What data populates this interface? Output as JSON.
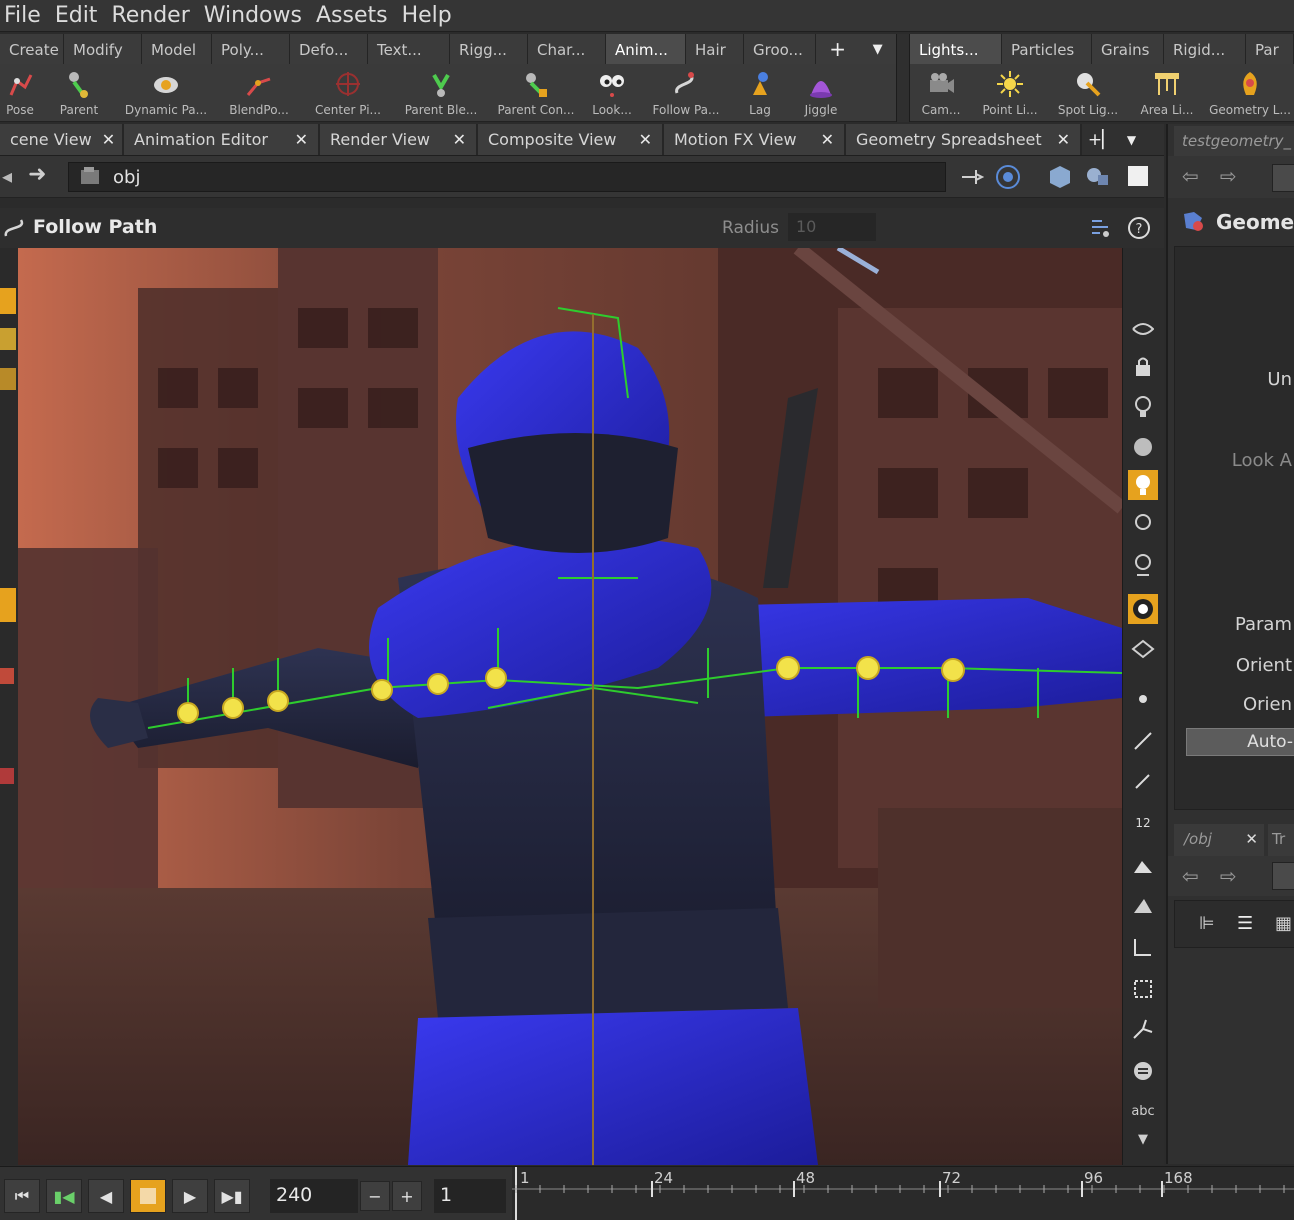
{
  "menu": [
    "File",
    "Edit",
    "Render",
    "Windows",
    "Assets",
    "Help"
  ],
  "shelf_tabs_left": [
    "Create",
    "Modify",
    "Model",
    "Poly...",
    "Defo...",
    "Text...",
    "Rigg...",
    "Char...",
    "Anim...",
    "Hair",
    "Groo..."
  ],
  "shelf_active": "Anim...",
  "shelf_tabs_right": [
    "Lights...",
    "Particles",
    "Grains",
    "Rigid...",
    "Par"
  ],
  "tools_left": [
    "Pose",
    "Parent",
    "Dynamic Pa...",
    "BlendPo...",
    "Center Pi...",
    "Parent Ble...",
    "Parent Con...",
    "Look...",
    "Follow Pa...",
    "Lag",
    "Jiggle"
  ],
  "tools_right": [
    "Cam...",
    "Point Li...",
    "Spot Lig...",
    "Area Li...",
    "Geometry L..."
  ],
  "pane_tabs": [
    "cene View",
    "Animation Editor",
    "Render View",
    "Composite View",
    "Motion FX View",
    "Geometry Spreadsheet"
  ],
  "path": "obj",
  "operation": {
    "title": "Follow Path",
    "radius_label": "Radius",
    "radius_value": "10"
  },
  "right_pane": {
    "tab": "testgeometry_",
    "title": "Geomet",
    "texts": [
      "Un",
      "Look A",
      "Param",
      "Orient",
      "Orien"
    ],
    "button": "Auto-",
    "lower_tab": "/obj",
    "lower_tab2": "Tr"
  },
  "playbar": {
    "current_frame": "240",
    "start_frame": "1",
    "ticks": [
      "1",
      "24",
      "48",
      "72",
      "96",
      "168"
    ]
  },
  "right_toolbar_label": "abc",
  "right_toolbar_num": "12",
  "colors": {
    "accent": "#e6a21e",
    "skeleton_green": "#2ecc2e",
    "joint_yellow": "#f2e24a",
    "costume_blue": "#2b2fd0"
  }
}
